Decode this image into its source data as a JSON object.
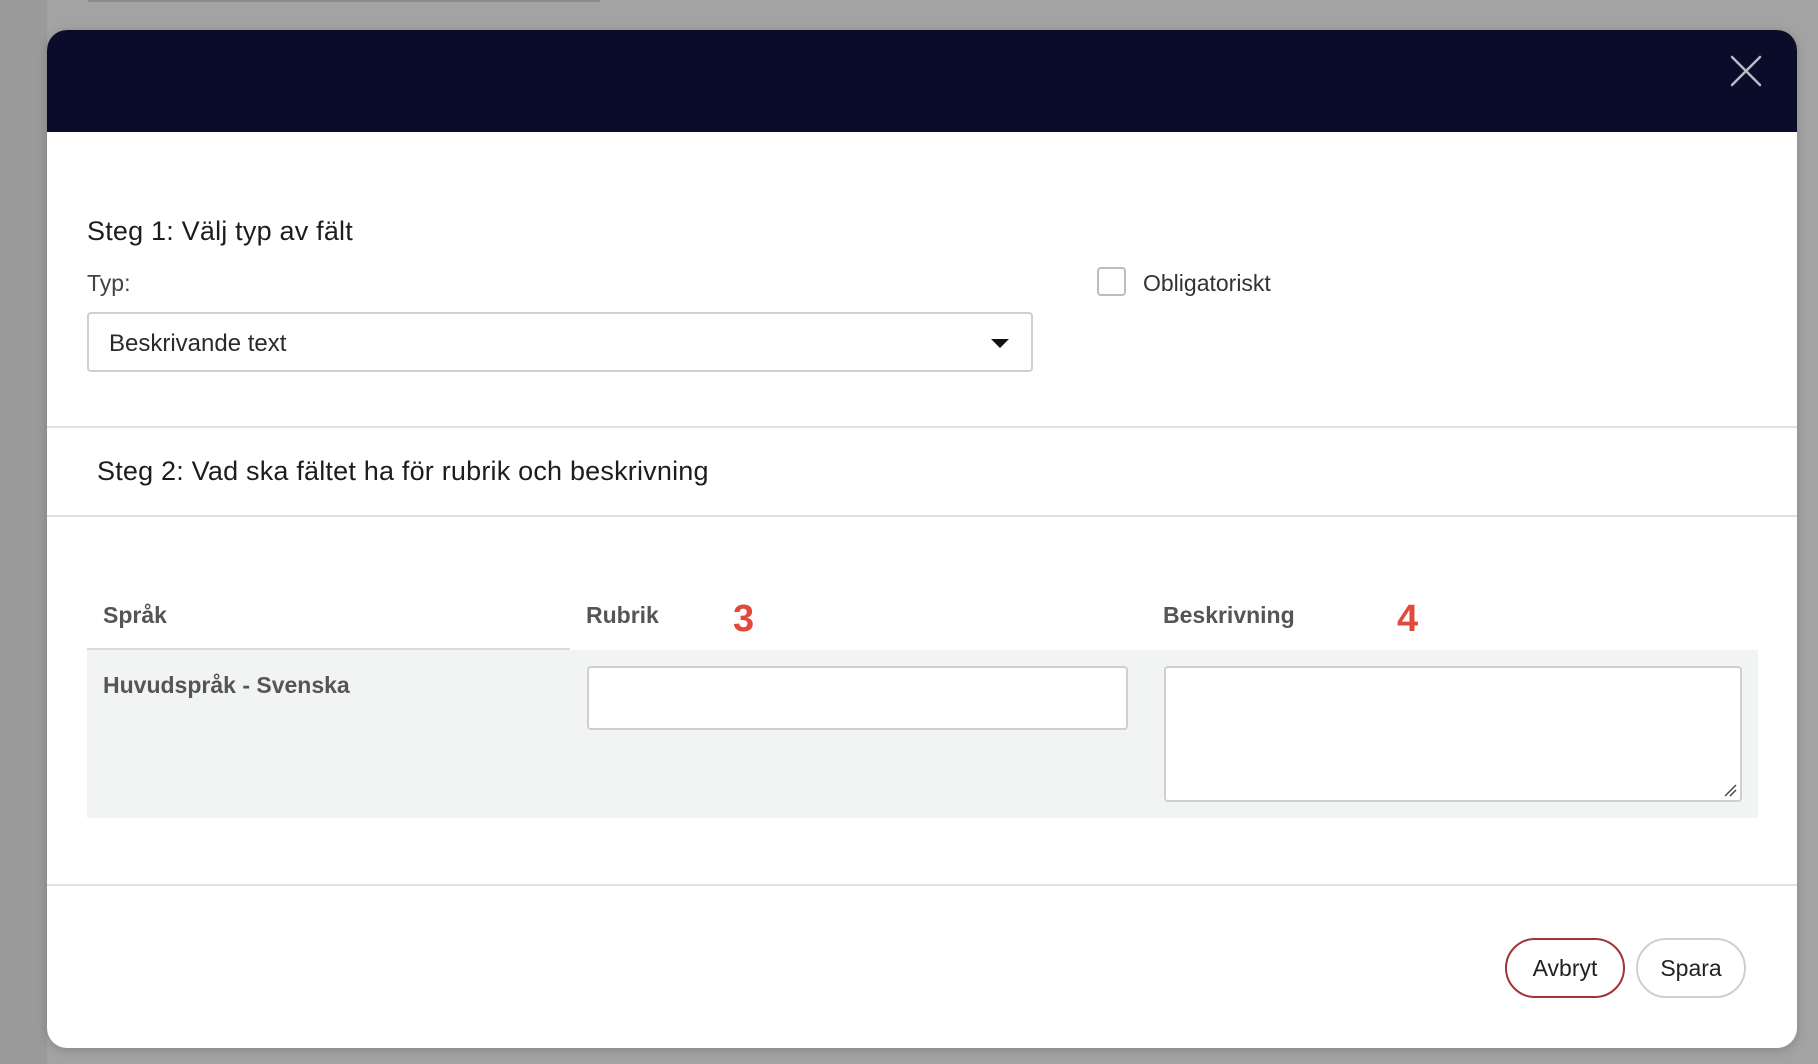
{
  "dialog": {
    "close_label": "close"
  },
  "step1": {
    "title": "Steg 1: Välj typ av fält",
    "type_label": "Typ:",
    "type_value": "Beskrivande text",
    "obligatory_label": "Obligatoriskt",
    "obligatory_checked": false
  },
  "step2": {
    "title": "Steg 2: Vad ska fältet ha för rubrik och beskrivning",
    "columns": {
      "language": "Språk",
      "heading": "Rubrik",
      "description": "Beskrivning"
    },
    "markers": {
      "heading": "3",
      "description": "4"
    },
    "rows": [
      {
        "language": "Huvudspråk - Svenska",
        "heading_value": "",
        "description_value": ""
      }
    ]
  },
  "footer": {
    "cancel_label": "Avbryt",
    "save_label": "Spara"
  },
  "colors": {
    "header_bg": "#0b0c2a",
    "marker": "#e14a3a",
    "cancel_border": "#9e3434",
    "overlay": "#a3a3a3"
  },
  "icons": {
    "close": "close-icon",
    "dropdown": "caret-down-icon",
    "resize": "resize-grip-icon"
  }
}
